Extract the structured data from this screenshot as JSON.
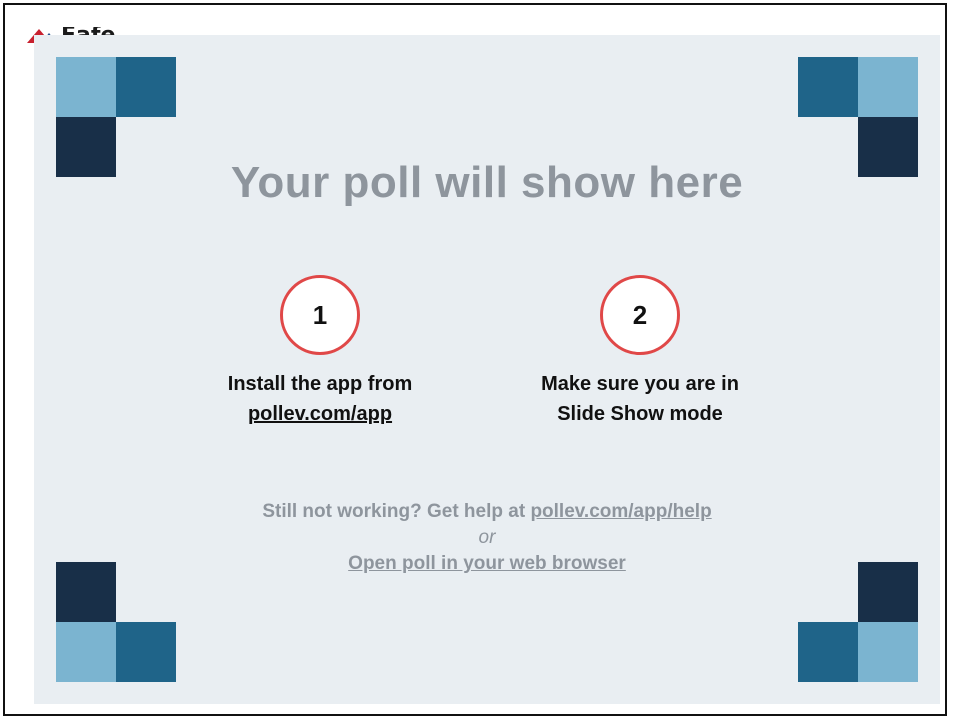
{
  "logo": {
    "text": "Eafe"
  },
  "title": "Your poll will show here",
  "steps": [
    {
      "number": "1",
      "line1": "Install the app from",
      "link": "pollev.com/app"
    },
    {
      "number": "2",
      "line1": "Make sure you are in",
      "line2": "Slide Show mode"
    }
  ],
  "help": {
    "prefix": "Still not working? Get help at ",
    "link": "pollev.com/app/help",
    "or": "or",
    "browser_link": "Open poll in your web browser"
  },
  "colors": {
    "light_square": "#7bb4d0",
    "mid_square": "#1f6489",
    "dark_square": "#182f48",
    "circle_border": "#e04848",
    "muted_text": "#8e959d",
    "panel_bg": "#e9eef2"
  }
}
